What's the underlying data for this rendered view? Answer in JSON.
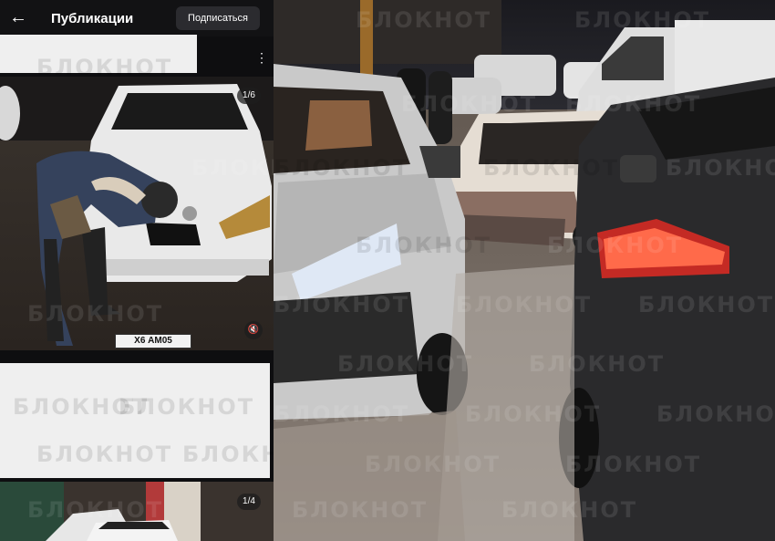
{
  "header": {
    "back_icon": "arrow-left-icon",
    "title": "Публикации",
    "subscribe_label": "Подписаться"
  },
  "post1": {
    "counter": "1/6",
    "menu_icon": "more-vertical-icon",
    "mute_icon": "speaker-muted-icon",
    "plate_text": "Х6 АМ05",
    "pager": {
      "total": 6,
      "active": 1
    }
  },
  "post2": {
    "counter": "1/4"
  },
  "watermark": "БЛОКНОТ",
  "colors": {
    "app_bg": "#0e0e10",
    "redaction": "#efefef",
    "pager_active": "#3b8ef0"
  }
}
